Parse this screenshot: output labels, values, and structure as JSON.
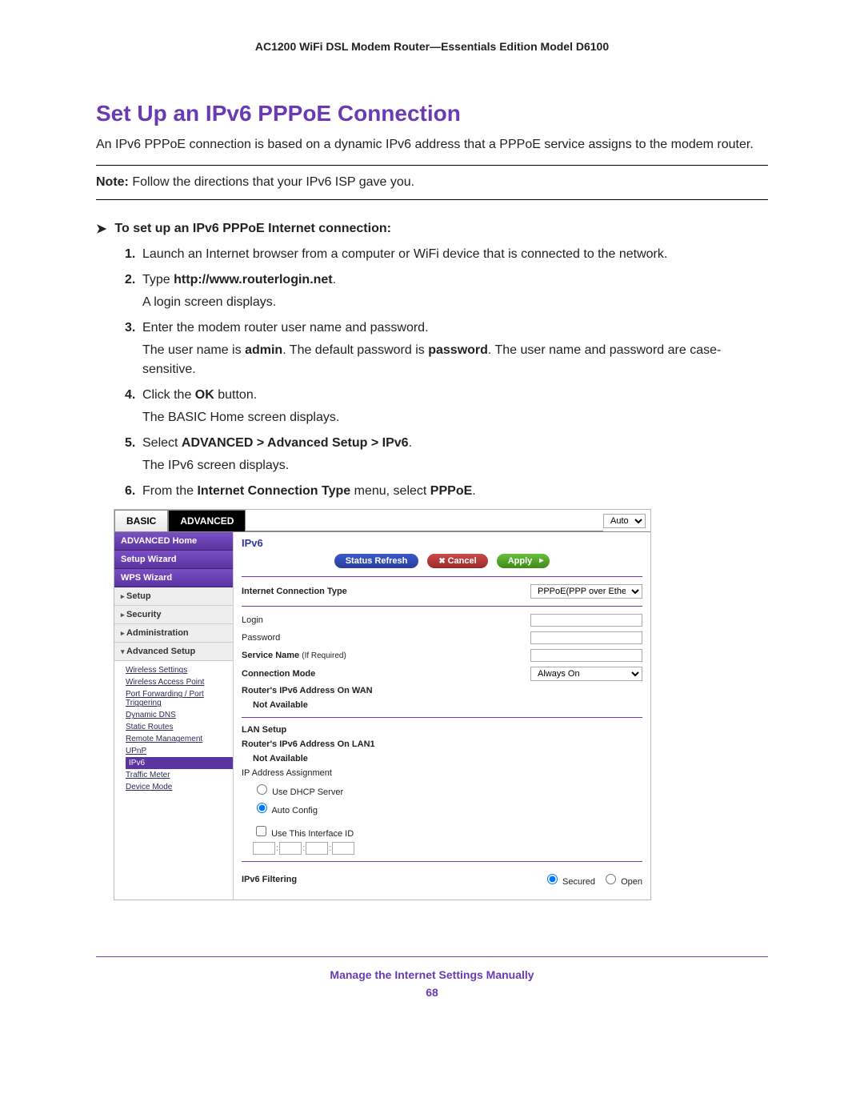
{
  "doc": {
    "header": "AC1200 WiFi DSL Modem Router—Essentials Edition Model D6100",
    "section_title": "Set Up an IPv6 PPPoE Connection",
    "intro": "An IPv6 PPPoE connection is based on a dynamic IPv6 address that a PPPoE service assigns to the modem router.",
    "note_label": "Note:",
    "note_text": " Follow the directions that your IPv6 ISP gave you.",
    "task_title": "To set up an IPv6 PPPoE Internet connection:",
    "steps": {
      "s1": "Launch an Internet browser from a computer or WiFi device that is connected to the network.",
      "s2a": "Type ",
      "s2b": "http://www.routerlogin.net",
      "s2c": ".",
      "s2sub": "A login screen displays.",
      "s3": "Enter the modem router user name and password.",
      "s3sub_a": "The user name is ",
      "s3sub_b": "admin",
      "s3sub_c": ". The default password is ",
      "s3sub_d": "password",
      "s3sub_e": ". The user name and password are case-sensitive.",
      "s4a": "Click the ",
      "s4b": "OK",
      "s4c": " button.",
      "s4sub": "The BASIC Home screen displays.",
      "s5a": "Select ",
      "s5b": "ADVANCED > Advanced Setup > IPv6",
      "s5c": ".",
      "s5sub": "The IPv6 screen displays.",
      "s6a": "From the ",
      "s6b": "Internet Connection Type",
      "s6c": " menu, select ",
      "s6d": "PPPoE",
      "s6e": "."
    },
    "footer": "Manage the Internet Settings Manually",
    "page_number": "68"
  },
  "ui": {
    "tabs": {
      "basic": "BASIC",
      "advanced": "ADVANCED"
    },
    "language": "Auto",
    "sidebar": {
      "adv_home": "ADVANCED Home",
      "setup_wizard": "Setup Wizard",
      "wps_wizard": "WPS Wizard",
      "setup": "Setup",
      "security": "Security",
      "administration": "Administration",
      "advanced_setup": "Advanced Setup",
      "links": {
        "wireless": "Wireless Settings",
        "wap": "Wireless Access Point",
        "portfwd": "Port Forwarding / Port Triggering",
        "ddns": "Dynamic DNS",
        "static": "Static Routes",
        "remote": "Remote Management",
        "upnp": "UPnP",
        "ipv6": "IPv6",
        "traffic": "Traffic Meter",
        "devmode": "Device Mode"
      }
    },
    "content": {
      "title": "IPv6",
      "btn_refresh": "Status Refresh",
      "btn_cancel": "Cancel",
      "btn_apply": "Apply",
      "ict_label": "Internet Connection Type",
      "ict_value": "PPPoE(PPP over Ethernet)",
      "login_label": "Login",
      "password_label": "Password",
      "service_label": "Service Name",
      "service_hint": "(If Required)",
      "conn_mode_label": "Connection Mode",
      "conn_mode_value": "Always On",
      "wan_addr_label": "Router's IPv6 Address On WAN",
      "not_available": "Not Available",
      "lan_setup": "LAN Setup",
      "lan_addr_label": "Router's IPv6 Address On LAN1",
      "ip_assign": "IP Address Assignment",
      "dhcp": "Use DHCP Server",
      "auto": "Auto Config",
      "iface_id": "Use This Interface ID",
      "filter_label": "IPv6 Filtering",
      "secured": "Secured",
      "open": "Open"
    }
  }
}
